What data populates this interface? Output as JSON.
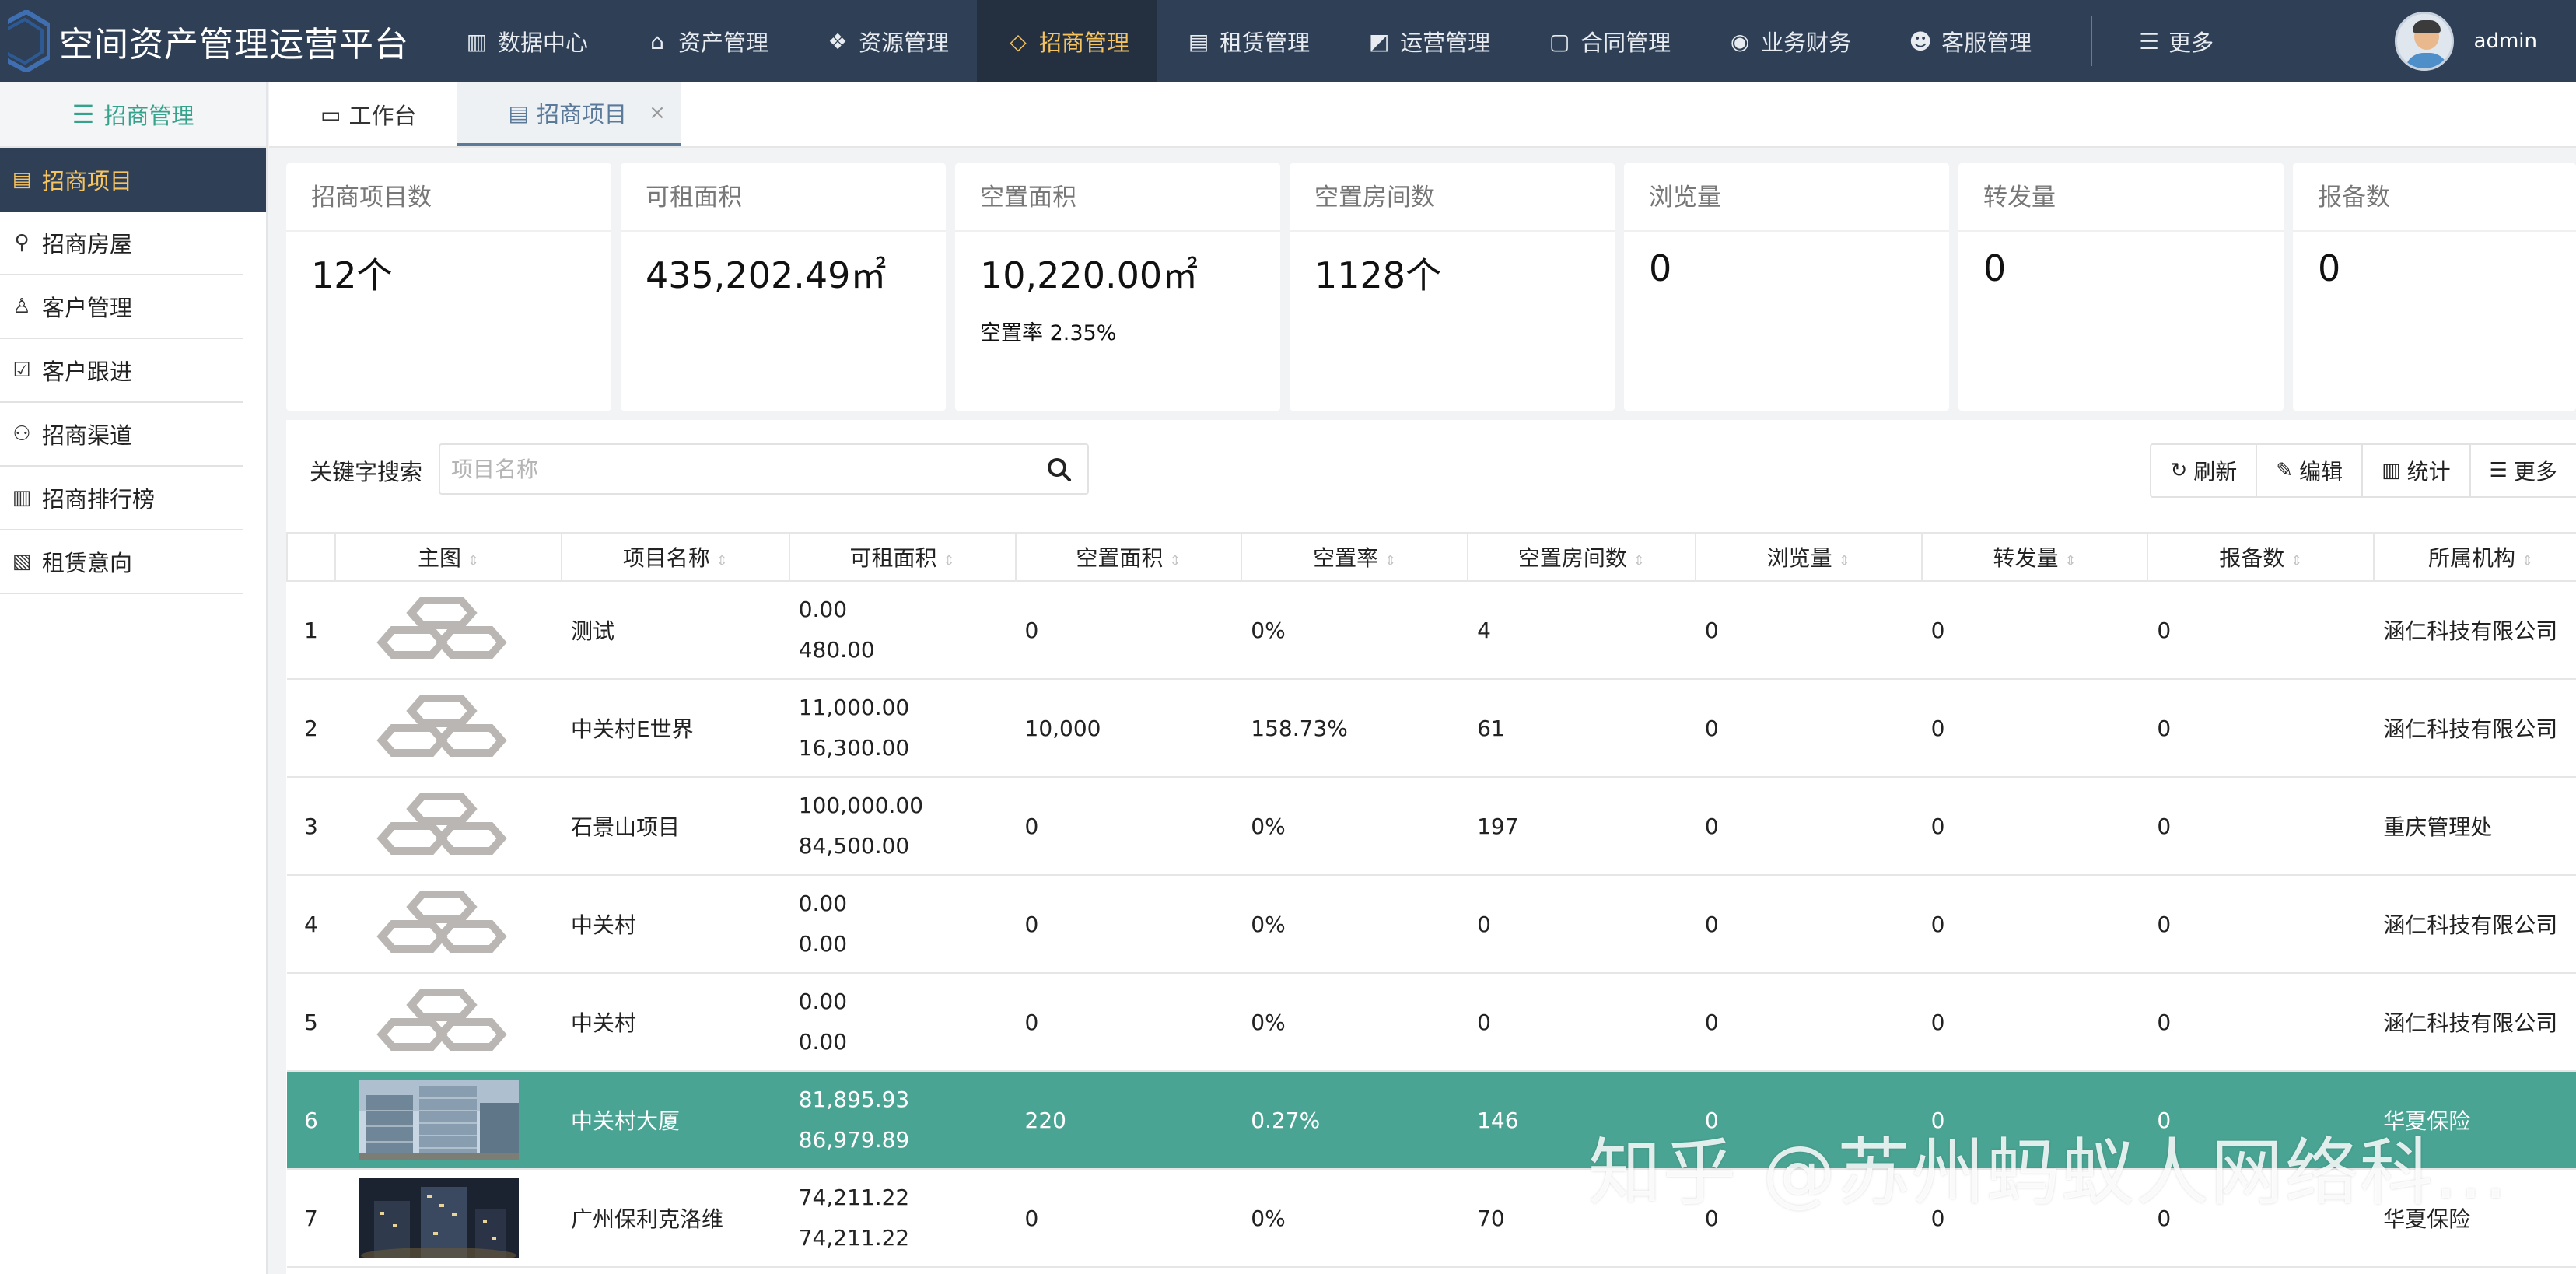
{
  "app": {
    "title": "空间资产管理运营平台"
  },
  "nav": [
    {
      "label": "数据中心",
      "icon": "bar-chart-icon"
    },
    {
      "label": "资产管理",
      "icon": "bank-icon"
    },
    {
      "label": "资源管理",
      "icon": "cubes-icon"
    },
    {
      "label": "招商管理",
      "icon": "diamond-icon",
      "active": true
    },
    {
      "label": "租赁管理",
      "icon": "file-icon"
    },
    {
      "label": "运营管理",
      "icon": "bag-icon"
    },
    {
      "label": "合同管理",
      "icon": "contract-icon"
    },
    {
      "label": "业务财务",
      "icon": "circle-icon"
    },
    {
      "label": "客服管理",
      "icon": "users-icon"
    }
  ],
  "nav_more": "更多",
  "user": {
    "name": "admin"
  },
  "sidebar": {
    "title": "招商管理",
    "items": [
      {
        "label": "招商项目",
        "icon": "document-icon",
        "active": true
      },
      {
        "label": "招商房屋",
        "icon": "map-pin-icon"
      },
      {
        "label": "客户管理",
        "icon": "user-icon"
      },
      {
        "label": "客户跟进",
        "icon": "calendar-check-icon"
      },
      {
        "label": "招商渠道",
        "icon": "channel-icon"
      },
      {
        "label": "招商排行榜",
        "icon": "ranking-icon"
      },
      {
        "label": "租赁意向",
        "icon": "intent-icon"
      }
    ]
  },
  "tabs": [
    {
      "label": "工作台",
      "icon": "monitor-icon"
    },
    {
      "label": "招商项目",
      "icon": "document-icon",
      "active": true,
      "close": "×"
    }
  ],
  "stats": [
    {
      "title": "招商项目数",
      "value": "12个"
    },
    {
      "title": "可租面积",
      "value": "435,202.49㎡"
    },
    {
      "title": "空置面积",
      "value": "10,220.00㎡",
      "sub": "空置率 2.35%"
    },
    {
      "title": "空置房间数",
      "value": "1128个"
    },
    {
      "title": "浏览量",
      "value": "0"
    },
    {
      "title": "转发量",
      "value": "0"
    },
    {
      "title": "报备数",
      "value": "0"
    }
  ],
  "search": {
    "label": "关键字搜索",
    "placeholder": "项目名称"
  },
  "toolbar": [
    {
      "label": "刷新",
      "icon": "refresh-icon"
    },
    {
      "label": "编辑",
      "icon": "edit-icon"
    },
    {
      "label": "统计",
      "icon": "stats-icon"
    },
    {
      "label": "更多",
      "icon": "menu-icon"
    }
  ],
  "table": {
    "columns": [
      "",
      "主图",
      "项目名称",
      "可租面积",
      "空置面积",
      "空置率",
      "空置房间数",
      "浏览量",
      "转发量",
      "报备数",
      "所属机构"
    ],
    "rows": [
      {
        "idx": "1",
        "image": "logo",
        "name": "测试",
        "area": [
          "0.00",
          "480.00"
        ],
        "vacant": "0",
        "rate": "0%",
        "rooms": "4",
        "views": "0",
        "shares": "0",
        "reports": "0",
        "org": "涵仁科技有限公司"
      },
      {
        "idx": "2",
        "image": "logo",
        "name": "中关村E世界",
        "area": [
          "11,000.00",
          "16,300.00"
        ],
        "vacant": "10,000",
        "rate": "158.73%",
        "rooms": "61",
        "views": "0",
        "shares": "0",
        "reports": "0",
        "org": "涵仁科技有限公司"
      },
      {
        "idx": "3",
        "image": "logo",
        "name": "石景山项目",
        "area": [
          "100,000.00",
          "84,500.00"
        ],
        "vacant": "0",
        "rate": "0%",
        "rooms": "197",
        "views": "0",
        "shares": "0",
        "reports": "0",
        "org": "重庆管理处"
      },
      {
        "idx": "4",
        "image": "logo",
        "name": "中关村",
        "area": [
          "0.00",
          "0.00"
        ],
        "vacant": "0",
        "rate": "0%",
        "rooms": "0",
        "views": "0",
        "shares": "0",
        "reports": "0",
        "org": "涵仁科技有限公司"
      },
      {
        "idx": "5",
        "image": "logo",
        "name": "中关村",
        "area": [
          "0.00",
          "0.00"
        ],
        "vacant": "0",
        "rate": "0%",
        "rooms": "0",
        "views": "0",
        "shares": "0",
        "reports": "0",
        "org": "涵仁科技有限公司"
      },
      {
        "idx": "6",
        "image": "photo-building",
        "name": "中关村大厦",
        "area": [
          "81,895.93",
          "86,979.89"
        ],
        "vacant": "220",
        "rate": "0.27%",
        "rooms": "146",
        "views": "0",
        "shares": "0",
        "reports": "0",
        "org": "华夏保险",
        "highlight": true
      },
      {
        "idx": "7",
        "image": "photo-night",
        "name": "广州保利克洛维",
        "area": [
          "74,211.22",
          "74,211.22"
        ],
        "vacant": "0",
        "rate": "0%",
        "rooms": "70",
        "views": "0",
        "shares": "0",
        "reports": "0",
        "org": "华夏保险"
      }
    ]
  },
  "watermark": "知乎 @苏州蚂蚁人网络科...",
  "colors": {
    "header": "#2f4056",
    "accent": "#f7c35f",
    "highlight_row": "#4aa493",
    "sidebar_title": "#35a38b"
  }
}
